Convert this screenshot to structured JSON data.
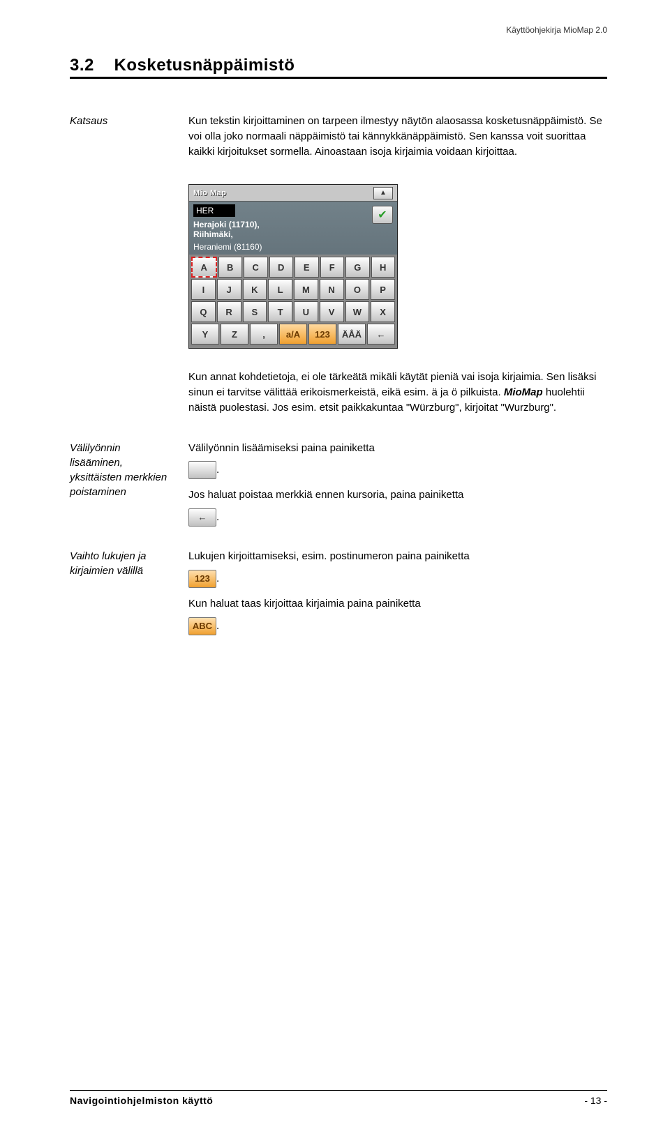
{
  "header": {
    "doc_title": "Käyttöohjekirja MioMap 2.0"
  },
  "section": {
    "number": "3.2",
    "title": "Kosketusnäppäimistö"
  },
  "katsaus": {
    "label": "Katsaus",
    "p1": "Kun tekstin kirjoittaminen on tarpeen ilmestyy näytön alaosassa kosketusnäppäimistö. Se voi olla joko normaali näppäimistö tai kännykkänäppäimistö. Sen kanssa voit suorittaa kaikki kirjoitukset sormella. Ainoastaan isoja kirjaimia voidaan kirjoittaa."
  },
  "screenshot": {
    "logo": "Mio Map",
    "input_value": "HER",
    "suggestion1": "Herajoki (11710),",
    "suggestion2": "Riihimäki,",
    "suggestion3": "Heraniemi (81160)",
    "row1": [
      "A",
      "B",
      "C",
      "D",
      "E",
      "F",
      "G",
      "H"
    ],
    "row2": [
      "I",
      "J",
      "K",
      "L",
      "M",
      "N",
      "O",
      "P"
    ],
    "row3": [
      "Q",
      "R",
      "S",
      "T",
      "U",
      "V",
      "W",
      "X"
    ],
    "row4": [
      "Y",
      "Z",
      ",",
      "a/A",
      "123",
      "ÄÅÄ",
      "←"
    ]
  },
  "para2": {
    "t1": "Kun annat kohdetietoja, ei ole tärkeätä mikäli käytät pieniä vai isoja kirjaimia. Sen lisäksi sinun ei tarvitse välittää erikoismerkeistä, eikä esim. ä ja ö pilkuista. ",
    "brand": "MioMap",
    "t2": " huolehtii näistä puolestasi. Jos esim. etsit paikkakuntaa \"Würzburg\", kirjoitat \"Wurzburg\"."
  },
  "vali": {
    "label": "Välilyönnin lisääminen, yksittäisten merkkien poistaminen",
    "p1": "Välilyönnin lisäämiseksi paina painiketta",
    "p2": "Jos haluat poistaa merkkiä ennen kursoria, paina painiketta"
  },
  "vaihto": {
    "label": "Vaihto lukujen ja kirjaimien välillä",
    "p1": "Lukujen kirjoittamiseksi, esim. postinumeron paina painiketta",
    "p2": "Kun haluat taas kirjoittaa kirjaimia paina painiketta",
    "btn123": "123",
    "btnABC": "ABC"
  },
  "footer": {
    "left": "Navigointiohjelmiston käyttö",
    "right": "- 13 -"
  }
}
